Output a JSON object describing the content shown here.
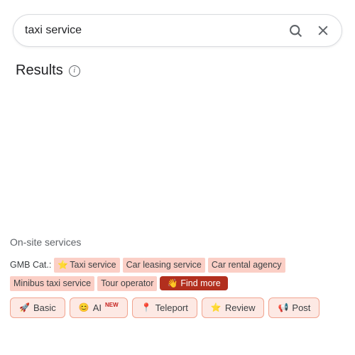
{
  "search": {
    "value": "taxi service"
  },
  "results": {
    "title": "Results"
  },
  "onsite": {
    "label": "On-site services"
  },
  "gmb": {
    "prefix": "GMB Cat.:",
    "categories": [
      "Taxi service",
      "Car leasing service",
      "Car rental agency",
      "Minibus taxi service",
      "Tour operator"
    ],
    "findMore": "Find more"
  },
  "actions": {
    "basic": "Basic",
    "ai": "AI",
    "aiNew": "NEW",
    "teleport": "Teleport",
    "review": "Review",
    "post": "Post"
  }
}
